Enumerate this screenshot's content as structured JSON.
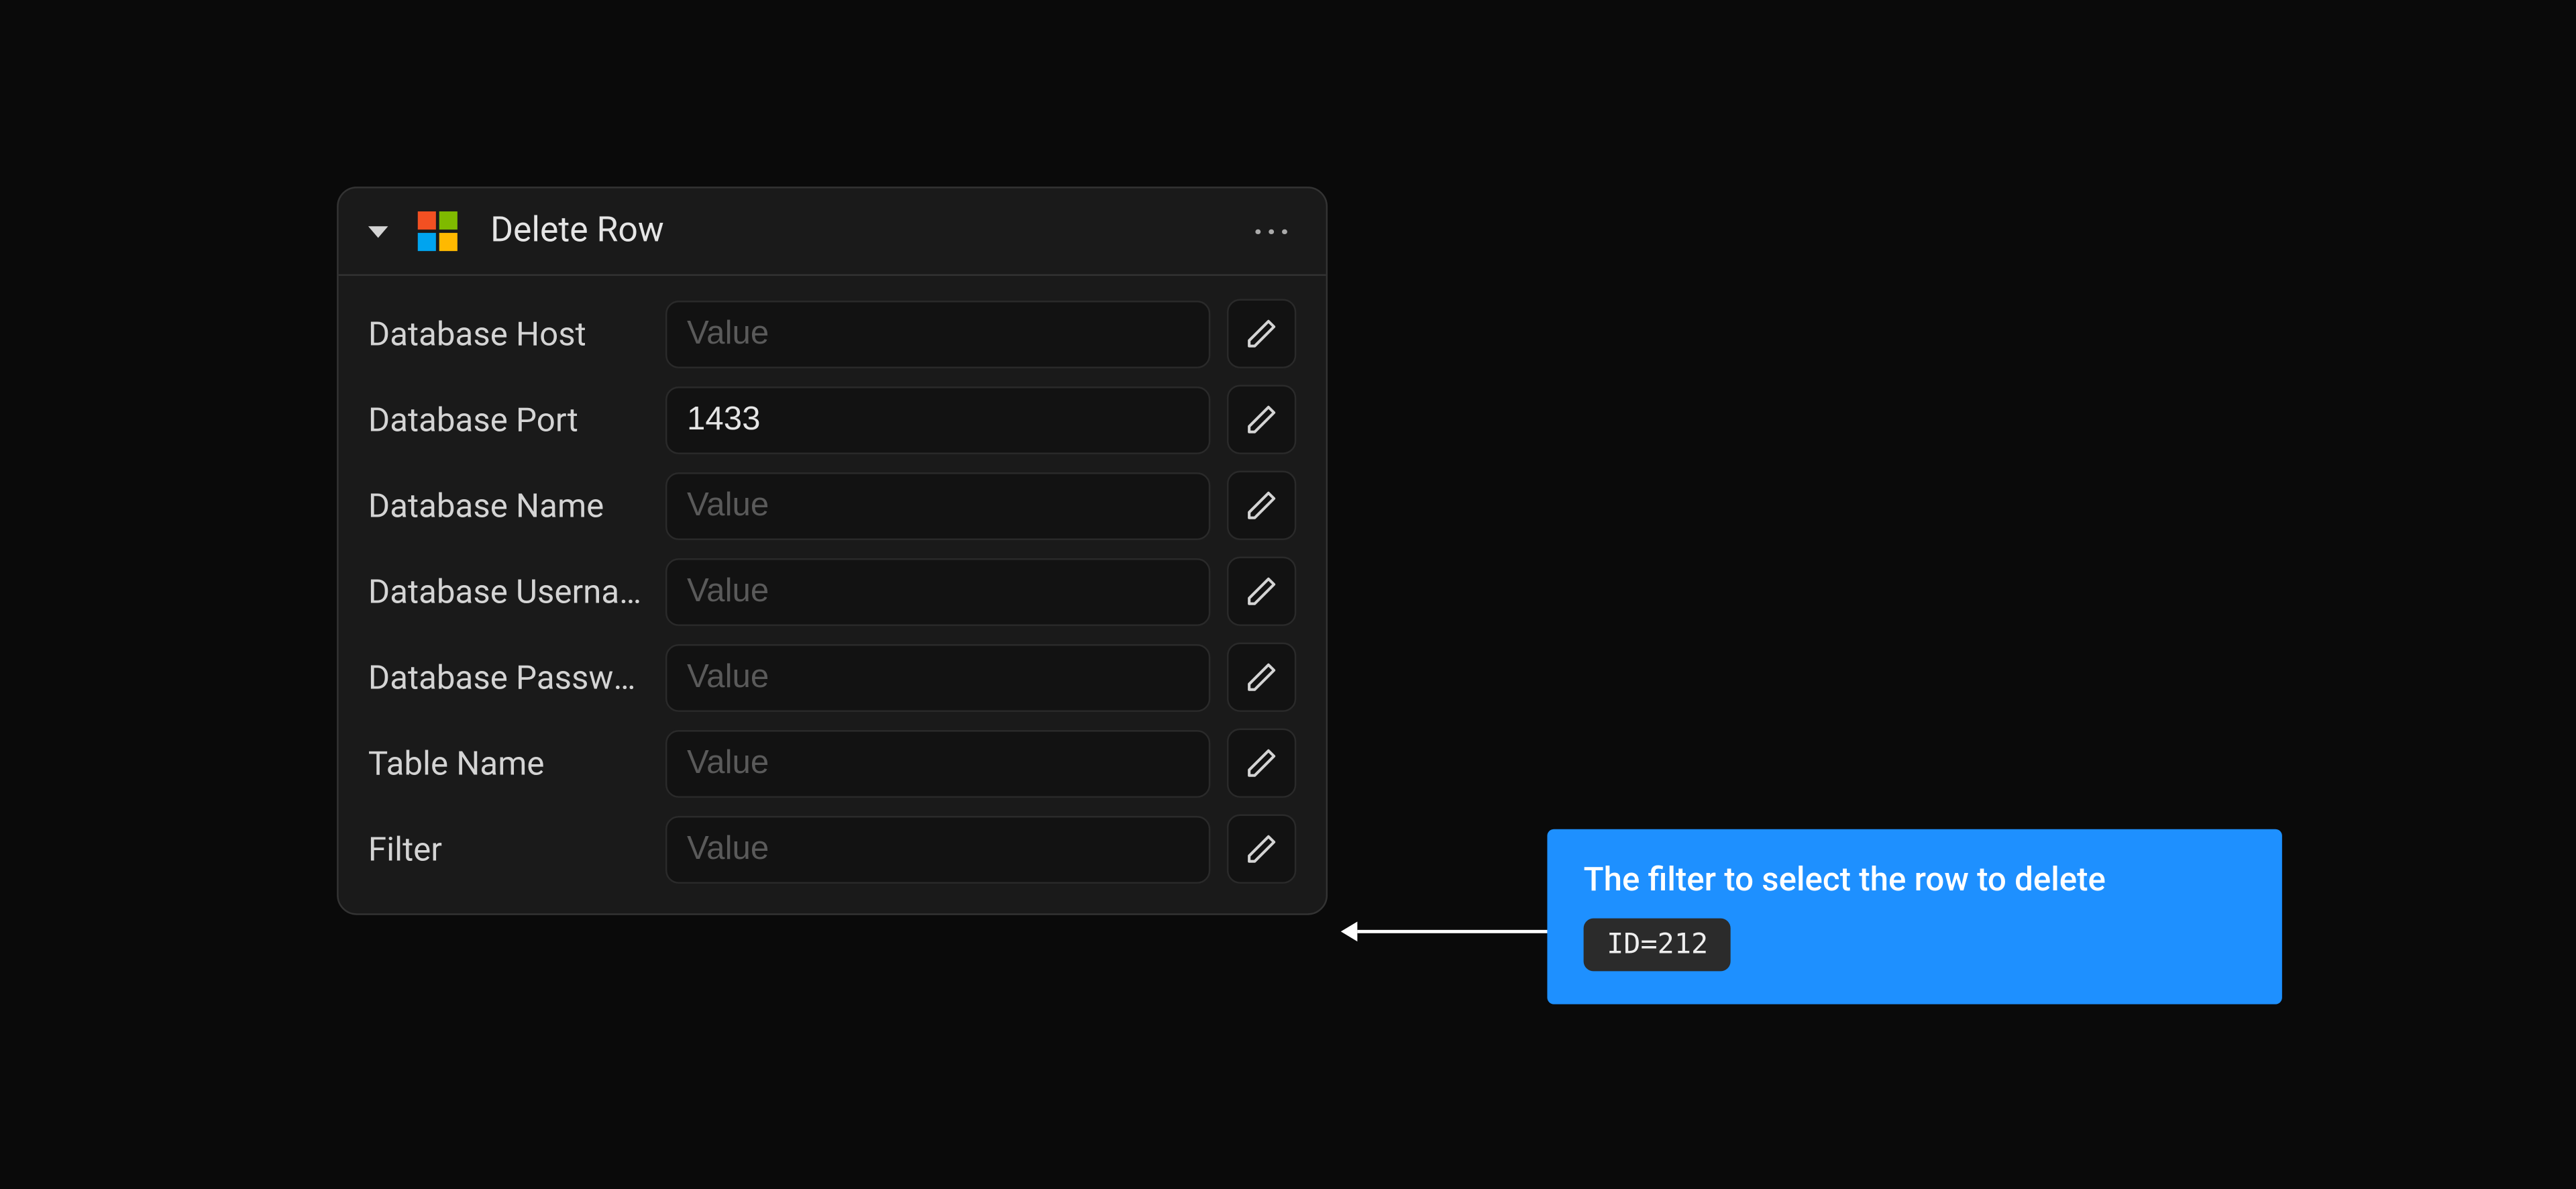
{
  "panel": {
    "title": "Delete Row",
    "icon": "microsoft-icon",
    "fields": [
      {
        "label": "Database Host",
        "placeholder": "Value",
        "value": ""
      },
      {
        "label": "Database Port",
        "placeholder": "Value",
        "value": "1433"
      },
      {
        "label": "Database Name",
        "placeholder": "Value",
        "value": ""
      },
      {
        "label": "Database Username",
        "placeholder": "Value",
        "value": ""
      },
      {
        "label": "Database Password",
        "placeholder": "Value",
        "value": ""
      },
      {
        "label": "Table Name",
        "placeholder": "Value",
        "value": ""
      },
      {
        "label": "Filter",
        "placeholder": "Value",
        "value": ""
      }
    ]
  },
  "callout": {
    "title": "The filter to select the row to delete",
    "example": "ID=212"
  }
}
